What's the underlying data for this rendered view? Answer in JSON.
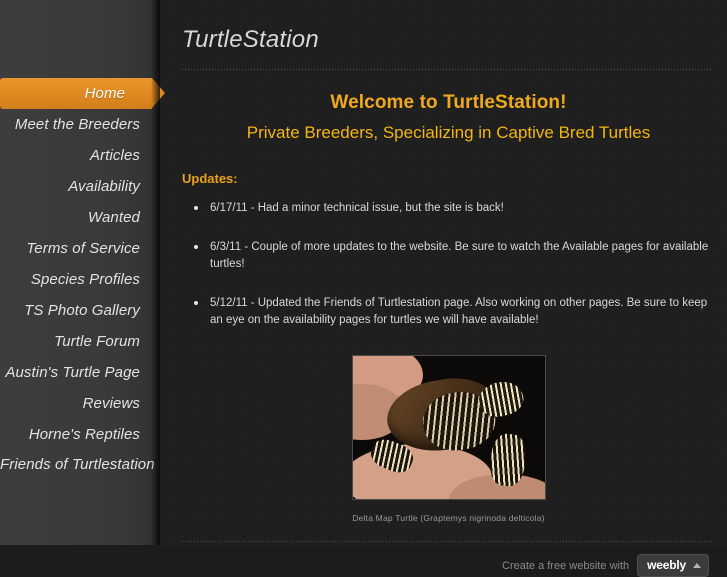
{
  "site": {
    "title": "TurtleStation"
  },
  "sidebar": {
    "items": [
      {
        "label": "Home",
        "active": true
      },
      {
        "label": "Meet the Breeders",
        "active": false
      },
      {
        "label": "Articles",
        "active": false
      },
      {
        "label": "Availability",
        "active": false
      },
      {
        "label": "Wanted",
        "active": false
      },
      {
        "label": "Terms of Service",
        "active": false
      },
      {
        "label": "Species Profiles",
        "active": false
      },
      {
        "label": "TS Photo Gallery",
        "active": false
      },
      {
        "label": "Turtle Forum",
        "active": false
      },
      {
        "label": "Austin's Turtle Page",
        "active": false
      },
      {
        "label": "Reviews",
        "active": false
      },
      {
        "label": "Horne's Reptiles",
        "active": false
      },
      {
        "label": "Friends of Turtlestation",
        "active": false
      }
    ]
  },
  "main": {
    "welcome_heading": "Welcome to TurtleStation!",
    "welcome_subheading": "Private Breeders, Specializing in Captive Bred Turtles",
    "updates_label": "Updates:",
    "updates": [
      "6/17/11 - Had a minor technical issue, but the site is back!",
      "6/3/11 - Couple of more updates to the website.  Be sure to watch the Available pages for available turtles!",
      "5/12/11 - Updated the Friends of Turtlestation page.  Also working on other pages.  Be sure to keep an eye on the availability pages for turtles we will have available!"
    ],
    "photo": {
      "caption": "Delta Map Turtle (Graptemys nigrinoda delticola)",
      "alt": "hatchling map turtle held in a hand"
    }
  },
  "footer": {
    "text": "Create a free website with",
    "brand": "weebly"
  },
  "colors": {
    "sidebar_bg": "#3a3a3a",
    "content_bg": "#1f1f1f",
    "accent_orange": "#e08a22",
    "heading_gold": "#f0a81e",
    "subheading_gold": "#f5b512",
    "updates_gold": "#e8a317",
    "body_text": "#d8d8d8",
    "nav_text": "#e2e2e2"
  }
}
